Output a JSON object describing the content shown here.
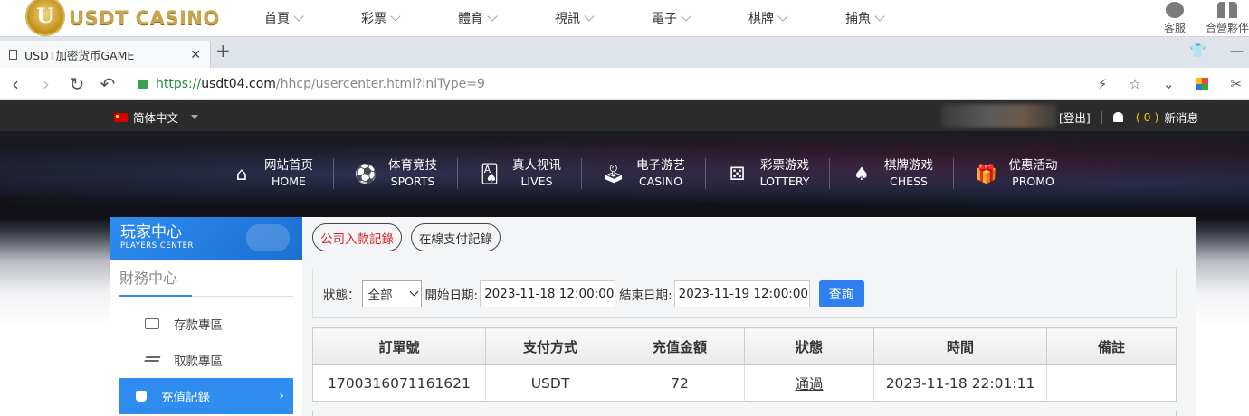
{
  "site": {
    "logo_text": "USDT CASINO",
    "logo_letter": "U",
    "nav": [
      "首頁",
      "彩票",
      "體育",
      "視訊",
      "電子",
      "棋牌",
      "捕魚"
    ],
    "right": [
      "客服",
      "合營夥伴"
    ]
  },
  "browser": {
    "tab_title": "USDT加密货币GAME",
    "new_tab": "+",
    "url_scheme": "https://",
    "url_host": "usdt04.com",
    "url_path": "/hhcp/usercenter.html?iniType=9"
  },
  "userbar": {
    "language": "简体中文",
    "logout": "[登出]",
    "msg_count": "( 0 )",
    "msg_label": "新消息"
  },
  "games": [
    {
      "cn": "网站首页",
      "en": "HOME",
      "icon": "home-icon",
      "glyph": "⌂"
    },
    {
      "cn": "体育竞技",
      "en": "SPORTS",
      "icon": "ball-icon",
      "glyph": "⚽"
    },
    {
      "cn": "真人视讯",
      "en": "LIVES",
      "icon": "cards-icon",
      "glyph": "🂡"
    },
    {
      "cn": "电子游艺",
      "en": "CASINO",
      "icon": "joystick-icon",
      "glyph": "🕹"
    },
    {
      "cn": "彩票游戏",
      "en": "LOTTERY",
      "icon": "dice-icon",
      "glyph": "⚄"
    },
    {
      "cn": "棋牌游戏",
      "en": "CHESS",
      "icon": "spade-icon",
      "glyph": "♠"
    },
    {
      "cn": "优惠活动",
      "en": "PROMO",
      "icon": "gift-icon",
      "glyph": "🎁"
    }
  ],
  "sidebar": {
    "title_cn": "玩家中心",
    "title_en": "PLAYERS CENTER",
    "section": "財務中心",
    "items": [
      {
        "label": "存款專區",
        "active": false
      },
      {
        "label": "取款專區",
        "active": false
      },
      {
        "label": "充值記錄",
        "active": true
      }
    ]
  },
  "records": {
    "tabs": [
      "公司入款記錄",
      "在線支付記錄"
    ],
    "filter": {
      "status_label": "狀態：",
      "status_value": "全部",
      "start_label": "開始日期:",
      "start_value": "2023-11-18 12:00:00",
      "end_label": "結束日期:",
      "end_value": "2023-11-19 12:00:00",
      "query": "查詢"
    },
    "columns": [
      "訂單號",
      "支付方式",
      "充值金額",
      "狀態",
      "時間",
      "備註"
    ],
    "rows": [
      [
        "1700316071161621",
        "USDT",
        "72",
        "通過",
        "2023-11-18 22:01:11",
        ""
      ]
    ]
  },
  "colors": {
    "accent": "#2f8df0",
    "active_tab_text": "#d8232a"
  }
}
